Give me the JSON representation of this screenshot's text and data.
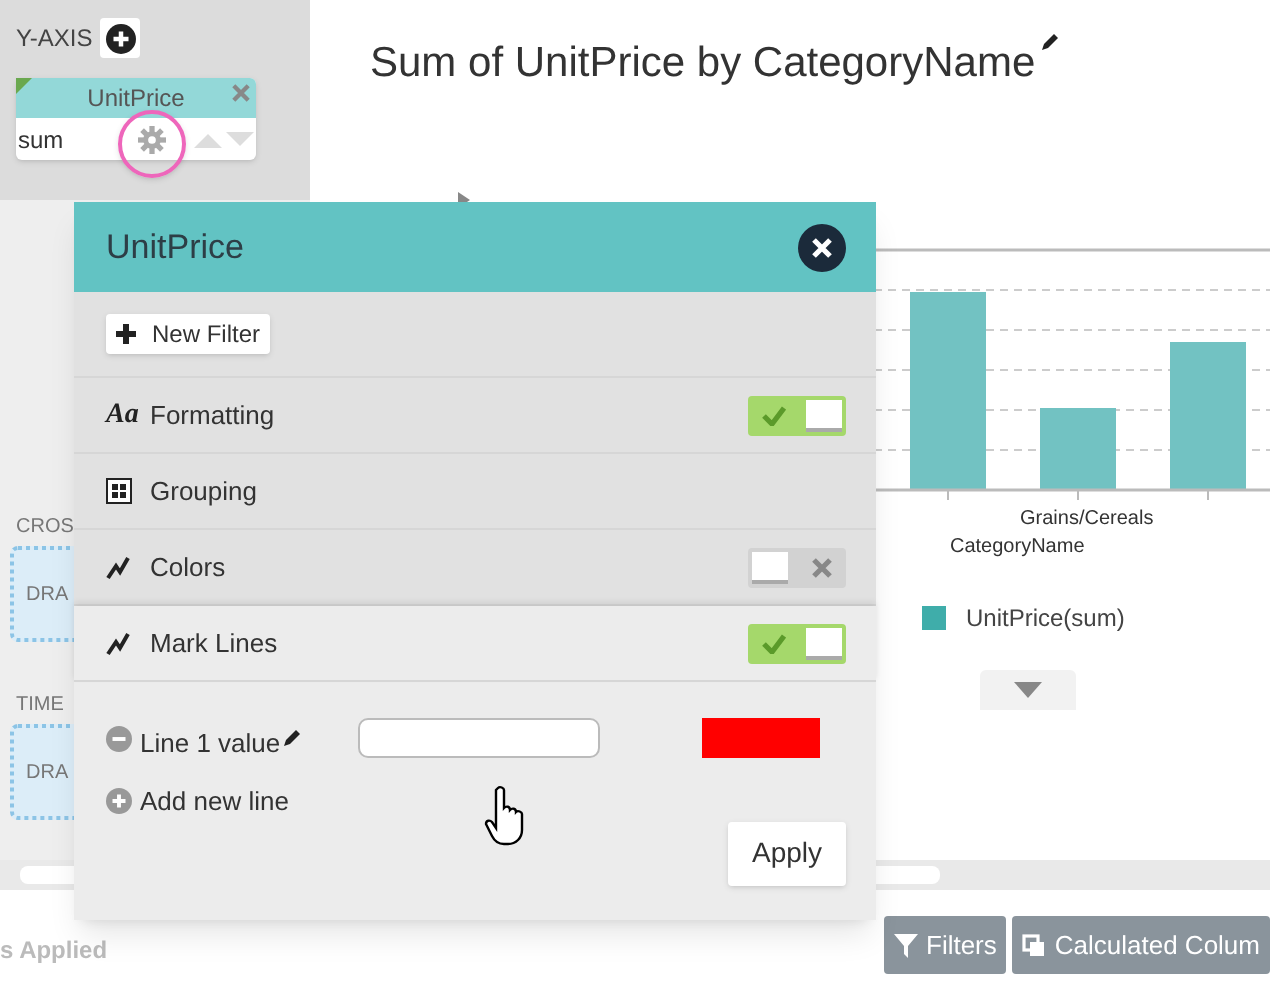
{
  "sidebar": {
    "y_axis": {
      "label": "Y-AXIS",
      "field": {
        "name": "UnitPrice",
        "aggregate": "sum"
      }
    },
    "sections": [
      {
        "label": "CROS",
        "drop_text": "DRA"
      },
      {
        "label": "TIME",
        "drop_text": "DRA"
      }
    ]
  },
  "chart": {
    "title": "Sum of UnitPrice by CategoryName",
    "category_label": "Grains/Cereals",
    "axis_title": "CategoryName",
    "legend": "UnitPrice(sum)"
  },
  "popup": {
    "title": "UnitPrice",
    "new_filter": "New Filter",
    "rows": [
      {
        "label": "Formatting",
        "glyph": "Aa",
        "kind": "toggle",
        "on": true,
        "expanded": false
      },
      {
        "label": "Grouping",
        "kind": "plain",
        "expanded": false
      },
      {
        "label": "Colors",
        "kind": "toggle",
        "on": false,
        "expanded": false
      },
      {
        "label": "Mark Lines",
        "kind": "toggle",
        "on": true,
        "expanded": true
      }
    ],
    "lines": [
      {
        "label": "Line 1 value",
        "color": "#ff0000"
      }
    ],
    "add_line": "Add new line",
    "apply": "Apply"
  },
  "footer": {
    "status": "s Applied",
    "buttons": [
      {
        "label": "Filters",
        "kind": "filter"
      },
      {
        "label": "Calculated Colum",
        "kind": "calc"
      }
    ]
  }
}
